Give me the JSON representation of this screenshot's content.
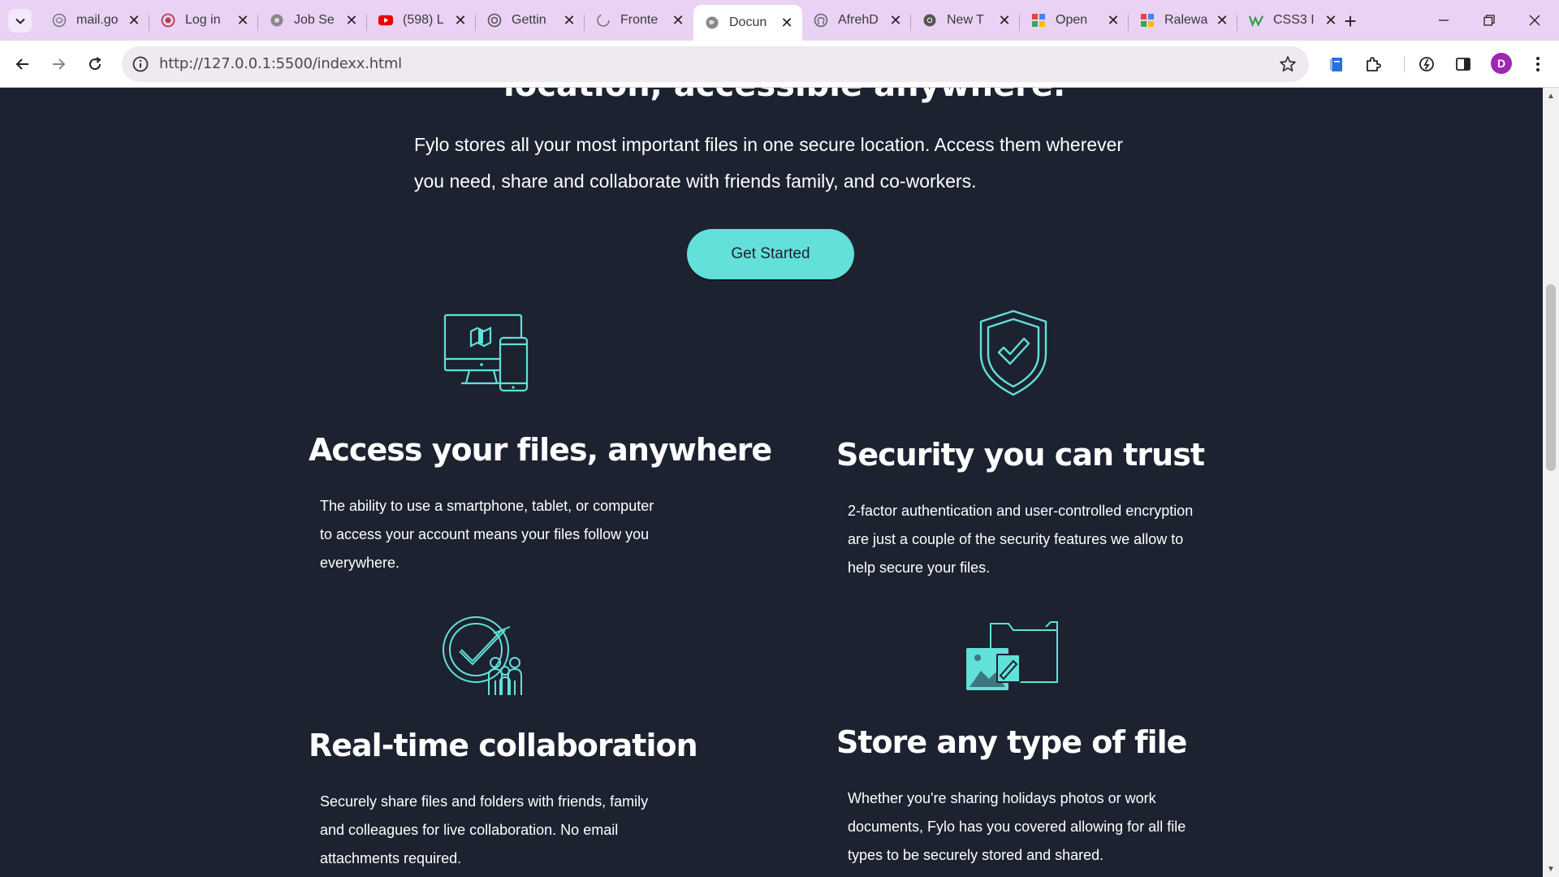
{
  "browser": {
    "tabs": [
      {
        "label": "mail.go",
        "icon": "globe-icon"
      },
      {
        "label": "Log in",
        "icon": "record-icon"
      },
      {
        "label": "Job Se",
        "icon": "globe-icon"
      },
      {
        "label": "(598) L",
        "icon": "youtube-icon"
      },
      {
        "label": "Gettin",
        "icon": "globe-icon"
      },
      {
        "label": "Fronte",
        "icon": "loading-icon"
      },
      {
        "label": "Docun",
        "icon": "globe-icon"
      },
      {
        "label": "AfrehD",
        "icon": "github-icon"
      },
      {
        "label": "New T",
        "icon": "chrome-icon"
      },
      {
        "label": "Open",
        "icon": "puzzle-icon"
      },
      {
        "label": "Ralewa",
        "icon": "puzzle-icon"
      },
      {
        "label": "CSS3 I",
        "icon": "w-icon"
      }
    ],
    "active_tab": 6,
    "url": "http://127.0.0.1:5500/indexx.html",
    "profile_initial": "D",
    "accent_color": "#e9d2f4"
  },
  "page": {
    "cut_heading": "location, accessible anywhere.",
    "intro": "Fylo stores all your most important files in one secure location. Access them wherever you need, share and collaborate with friends family, and co-workers.",
    "cta_label": "Get Started",
    "features": [
      {
        "title": "Access your files, anywhere",
        "desc": "The ability to use a smartphone, tablet, or computer to access your account means your files follow you everywhere.",
        "icon": "devices-icon"
      },
      {
        "title": "Security you can trust",
        "desc": "2-factor authentication and user-controlled encryption are just a couple of the security features we allow to help secure your files.",
        "icon": "shield-check-icon"
      },
      {
        "title": "Real-time collaboration",
        "desc": "Securely share files and folders with friends, family and colleagues for live collaboration. No email attachments required.",
        "icon": "collaboration-icon"
      },
      {
        "title": "Store any type of file",
        "desc": "Whether you're sharing holidays photos or work documents, Fylo has you covered allowing for all file types to be securely stored and shared.",
        "icon": "folder-files-icon"
      }
    ],
    "colors": {
      "background": "#1c2230",
      "accent": "#62e0d9",
      "text": "#ffffff"
    }
  }
}
